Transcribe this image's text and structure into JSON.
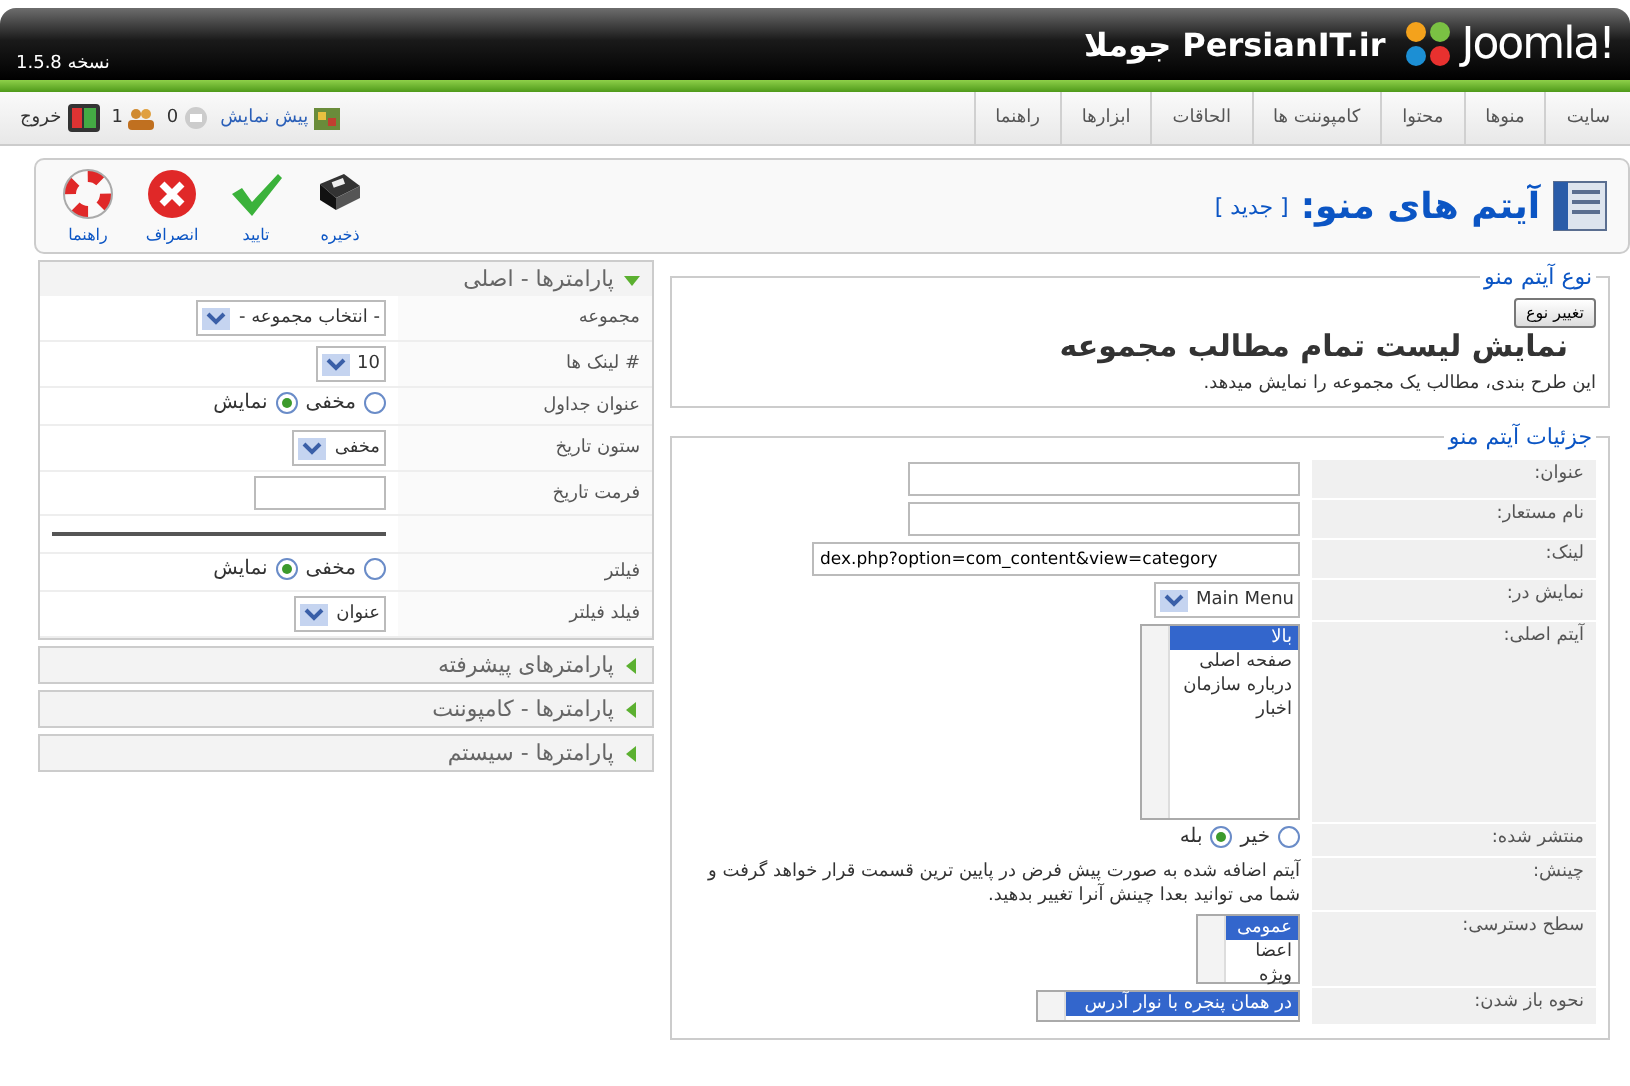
{
  "header": {
    "logo_text": "Joomla!",
    "site_title": "PersianIT.ir جوملا",
    "version": "نسخه 1.5.8"
  },
  "menubar": {
    "items": [
      "سایت",
      "منوها",
      "محتوا",
      "کامپوننت ها",
      "الحاقات",
      "ابزارها",
      "راهنما"
    ],
    "status": [
      {
        "kind": "preview",
        "label": "پیش نمایش"
      },
      {
        "kind": "messages",
        "label": "0"
      },
      {
        "kind": "users",
        "label": "1"
      },
      {
        "kind": "logout",
        "label": "خروج"
      }
    ]
  },
  "toolbar": {
    "title": "آیتم های منو:",
    "subtitle": "[ جدید ]",
    "buttons": [
      {
        "kind": "save",
        "label": "ذخیره"
      },
      {
        "kind": "apply",
        "label": "تایید"
      },
      {
        "kind": "cancel",
        "label": "انصراف"
      },
      {
        "kind": "help",
        "label": "راهنما"
      }
    ]
  },
  "menu_type": {
    "legend": "نوع آیتم منو",
    "button": "تغییر نوع",
    "title": "نمایش لیست تمام مطالب مجموعه",
    "description": "این طرح بندی، مطالب یک مجموعه را نمایش میدهد."
  },
  "details": {
    "legend": "جزئیات آیتم منو",
    "rows": [
      {
        "kind": "text",
        "label": "عنوان:"
      },
      {
        "kind": "text",
        "label": "نام مستعار:"
      },
      {
        "kind": "text",
        "label": "لینک:",
        "value": "dex.php?option=com_content&view=category"
      },
      {
        "kind": "select",
        "label": "نمایش در:",
        "value": "Main Menu"
      },
      {
        "kind": "listbox",
        "label": "آیتم اصلی:",
        "options": [
          {
            "label": "بالا",
            "selected": true
          },
          {
            "label": "صفحه اصلی",
            "selected": false
          },
          {
            "label": "درباره سازمان",
            "selected": false
          },
          {
            "label": "اخبار",
            "selected": false
          }
        ]
      },
      {
        "kind": "radio",
        "label": "منتشر شده:",
        "options": [
          {
            "label": "خیر",
            "selected": false
          },
          {
            "label": "بله",
            "selected": true
          }
        ]
      },
      {
        "kind": "note",
        "label": "چینش:",
        "text": "آیتم اضافه شده به صورت پیش فرض در پایین ترین قسمت قرار خواهد گرفت و شما می توانید بعدا چینش آنرا تغییر بدهید."
      },
      {
        "kind": "listbox",
        "label": "سطح دسترسی:",
        "options": [
          {
            "label": "عمومی",
            "selected": true
          },
          {
            "label": "اعضا",
            "selected": false
          },
          {
            "label": "ویژه",
            "selected": false
          }
        ]
      },
      {
        "kind": "listbox",
        "label": "نحوه باز شدن:",
        "options": [
          {
            "label": "در همان پنجره با نوار آدرس",
            "selected": true
          }
        ]
      }
    ]
  },
  "parameters": [
    {
      "title": "پارامترها - اصلی",
      "expanded": true,
      "rows": [
        {
          "kind": "select",
          "label": "مجموعه",
          "value": "- انتخاب مجموعه -"
        },
        {
          "kind": "select",
          "label": "# لینک ها",
          "value": "10"
        },
        {
          "kind": "radio",
          "label": "عنوان جداول",
          "options": [
            {
              "label": "مخفی",
              "selected": false
            },
            {
              "label": "نمایش",
              "selected": true
            }
          ]
        },
        {
          "kind": "select",
          "label": "ستون تاریخ",
          "value": "مخفی"
        },
        {
          "kind": "text",
          "label": "فرمت تاریخ"
        },
        {
          "kind": "separator"
        },
        {
          "kind": "radio",
          "label": "فیلتر",
          "options": [
            {
              "label": "مخفی",
              "selected": false
            },
            {
              "label": "نمایش",
              "selected": true
            }
          ]
        },
        {
          "kind": "select",
          "label": "فیلد فیلتر",
          "value": "عنوان"
        }
      ]
    },
    {
      "title": "پارامترهای پیشرفته",
      "expanded": false
    },
    {
      "title": "پارامترها - کامپوننت",
      "expanded": false
    },
    {
      "title": "پارامترها - سیستم",
      "expanded": false
    }
  ]
}
